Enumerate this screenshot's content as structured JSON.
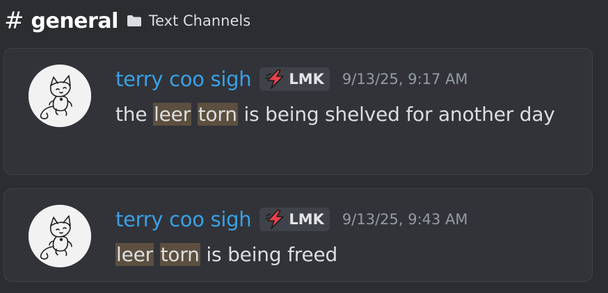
{
  "header": {
    "hash_symbol": "#",
    "channel_name": "general",
    "category_icon": "folder-icon",
    "category_name": "Text Channels"
  },
  "messages": [
    {
      "username": "terry coo sigh",
      "tag_icon": "lightning-bolt-icon",
      "tag": "LMK",
      "timestamp": "9/13/25, 9:17 AM",
      "body_parts": [
        {
          "text": "the ",
          "highlight": false
        },
        {
          "text": "leer",
          "highlight": true
        },
        {
          "text": " ",
          "highlight": false
        },
        {
          "text": "torn",
          "highlight": true
        },
        {
          "text": " is being shelved for another day",
          "highlight": false
        }
      ]
    },
    {
      "username": "terry coo sigh",
      "tag_icon": "lightning-bolt-icon",
      "tag": "LMK",
      "timestamp": "9/13/25, 9:43 AM",
      "body_parts": [
        {
          "text": "leer",
          "highlight": true
        },
        {
          "text": " ",
          "highlight": false
        },
        {
          "text": "torn",
          "highlight": true
        },
        {
          "text": " is being freed",
          "highlight": false
        }
      ]
    }
  ],
  "colors": {
    "background": "#2b2d31",
    "card": "#313338",
    "username": "#3aa0e6",
    "highlight": "#5c4f3f",
    "timestamp": "#949ba4",
    "tag_bolt": "#e8414c"
  }
}
